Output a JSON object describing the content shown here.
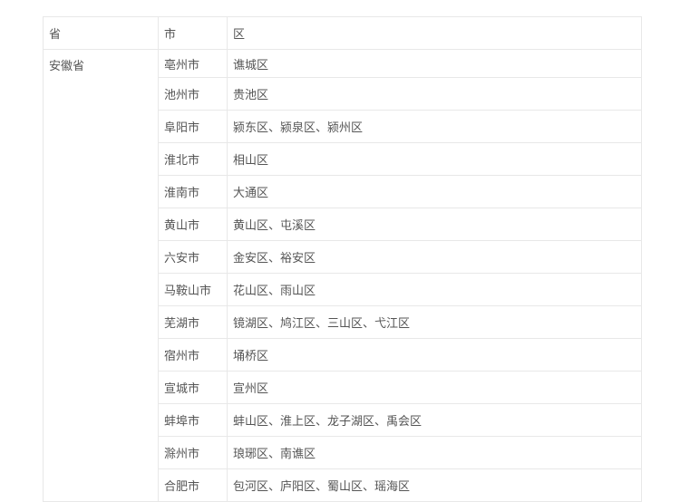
{
  "table": {
    "headers": {
      "province": "省",
      "city": "市",
      "district": "区"
    },
    "province": "安徽省",
    "rows": [
      {
        "city": "亳州市",
        "districts": "谯城区"
      },
      {
        "city": "池州市",
        "districts": "贵池区"
      },
      {
        "city": "阜阳市",
        "districts": "颍东区、颍泉区、颍州区"
      },
      {
        "city": "淮北市",
        "districts": "相山区"
      },
      {
        "city": "淮南市",
        "districts": "大通区"
      },
      {
        "city": "黄山市",
        "districts": "黄山区、屯溪区"
      },
      {
        "city": "六安市",
        "districts": "金安区、裕安区"
      },
      {
        "city": "马鞍山市",
        "districts": "花山区、雨山区"
      },
      {
        "city": "芜湖市",
        "districts": "镜湖区、鸠江区、三山区、弋江区"
      },
      {
        "city": "宿州市",
        "districts": "埇桥区"
      },
      {
        "city": "宣城市",
        "districts": "宣州区"
      },
      {
        "city": "蚌埠市",
        "districts": "蚌山区、淮上区、龙子湖区、禹会区"
      },
      {
        "city": "滁州市",
        "districts": "琅琊区、南谯区"
      },
      {
        "city": "合肥市",
        "districts": "包河区、庐阳区、蜀山区、瑶海区"
      }
    ]
  }
}
